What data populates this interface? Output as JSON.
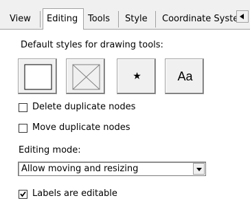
{
  "tabs": [
    {
      "label": "View",
      "active": false
    },
    {
      "label": "Editing",
      "active": true
    },
    {
      "label": "Tools",
      "active": false
    },
    {
      "label": "Style",
      "active": false
    },
    {
      "label": "Coordinate Syster",
      "active": false
    }
  ],
  "scroll_left_icon": "triangle-left-icon",
  "default_styles_label": "Default styles for drawing tools:",
  "tool_buttons": [
    {
      "name": "rectangle",
      "icon": "square-icon"
    },
    {
      "name": "ellipse",
      "icon": "x-cross-icon"
    },
    {
      "name": "point",
      "icon": "star-icon",
      "glyph": "★"
    },
    {
      "name": "text",
      "icon": "text-icon",
      "glyph": "Aa"
    }
  ],
  "options": {
    "delete_duplicate_nodes": {
      "label": "Delete duplicate nodes",
      "checked": false
    },
    "move_duplicate_nodes": {
      "label": "Move duplicate nodes",
      "checked": false
    },
    "labels_editable": {
      "label": "Labels are editable",
      "checked": true
    }
  },
  "editing_mode": {
    "label": "Editing mode:",
    "value": "Allow moving and resizing"
  }
}
